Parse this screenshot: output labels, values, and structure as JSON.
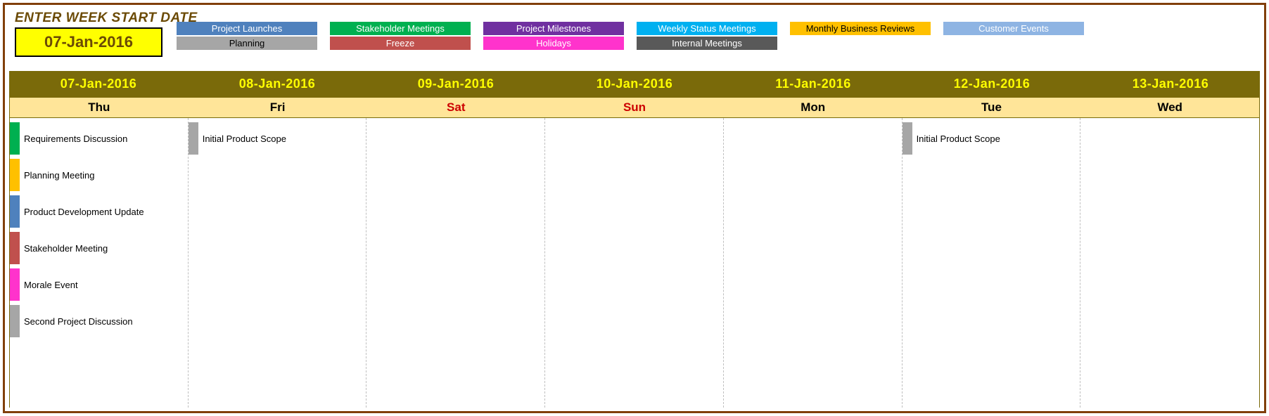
{
  "header": {
    "enter_label": "ENTER WEEK START DATE",
    "start_date": "07-Jan-2016"
  },
  "legend": {
    "row1": [
      {
        "label": "Project Launches",
        "class": "c-launches"
      },
      {
        "label": "Stakeholder Meetings",
        "class": "c-stake"
      },
      {
        "label": "Project Milestones",
        "class": "c-milestone"
      },
      {
        "label": "Weekly Status Meetings",
        "class": "c-weekly"
      },
      {
        "label": "Monthly Business Reviews",
        "class": "c-monthly"
      },
      {
        "label": "Customer Events",
        "class": "c-customer"
      }
    ],
    "row2": [
      {
        "label": "Planning",
        "class": "c-planning"
      },
      {
        "label": "Freeze",
        "class": "c-freeze"
      },
      {
        "label": "Holidays",
        "class": "c-holidays"
      },
      {
        "label": "Internal Meetings",
        "class": "c-internal"
      }
    ]
  },
  "dates": [
    "07-Jan-2016",
    "08-Jan-2016",
    "09-Jan-2016",
    "10-Jan-2016",
    "11-Jan-2016",
    "12-Jan-2016",
    "13-Jan-2016"
  ],
  "days": [
    {
      "label": "Thu",
      "weekend": false
    },
    {
      "label": "Fri",
      "weekend": false
    },
    {
      "label": "Sat",
      "weekend": true
    },
    {
      "label": "Sun",
      "weekend": true
    },
    {
      "label": "Mon",
      "weekend": false
    },
    {
      "label": "Tue",
      "weekend": false
    },
    {
      "label": "Wed",
      "weekend": false
    }
  ],
  "columns": [
    [
      {
        "label": "Requirements Discussion",
        "class": "c-stake"
      },
      {
        "label": "Planning Meeting",
        "class": "c-monthly"
      },
      {
        "label": "Product Development Update",
        "class": "c-launches"
      },
      {
        "label": "Stakeholder Meeting",
        "class": "c-freeze"
      },
      {
        "label": "Morale Event",
        "class": "c-holidays"
      },
      {
        "label": "Second Project Discussion",
        "class": "c-planning"
      }
    ],
    [
      {
        "label": "Initial Product Scope",
        "class": "c-planning"
      }
    ],
    [],
    [],
    [],
    [
      {
        "label": "Initial Product Scope",
        "class": "c-planning"
      }
    ],
    []
  ]
}
